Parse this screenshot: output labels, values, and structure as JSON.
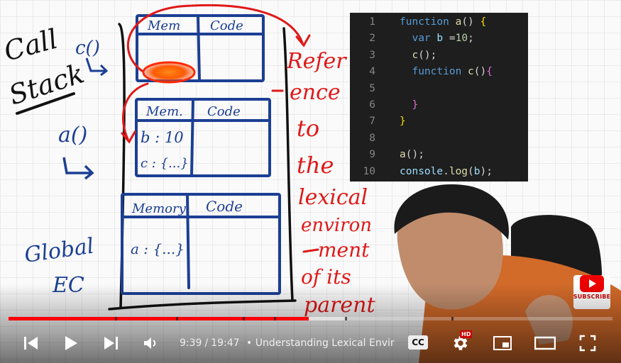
{
  "video": {
    "board": {
      "call_stack_label": [
        "Call",
        "Stack"
      ],
      "stack_entry_label": "c()",
      "a_call_label": "a()",
      "global_label": [
        "Global",
        "EC"
      ],
      "frames": [
        {
          "memory_header": "Mem",
          "code_header": "Code",
          "memory_items": []
        },
        {
          "memory_header": "Mem.",
          "code_header": "Code",
          "memory_items": [
            "b : 10",
            "c : {...}"
          ]
        },
        {
          "memory_header": "Memory",
          "code_header": "Code",
          "memory_items": [
            "a : {...}"
          ]
        }
      ],
      "annotation_words": [
        "Refer",
        "ence",
        "to",
        "the",
        "lexical",
        "environ",
        "ment",
        "of its",
        "parent"
      ]
    },
    "code": {
      "lines": [
        {
          "number": "1",
          "tokens": [
            {
              "t": "function ",
              "c": "kw"
            },
            {
              "t": "a",
              "c": "fn"
            },
            {
              "t": "() ",
              "c": "pl"
            },
            {
              "t": "{",
              "c": "br"
            }
          ]
        },
        {
          "number": "2",
          "tokens": [
            {
              "t": "  var ",
              "c": "kw"
            },
            {
              "t": "b ",
              "c": "id"
            },
            {
              "t": "=",
              "c": "pl"
            },
            {
              "t": "10",
              "c": "num"
            },
            {
              "t": ";",
              "c": "pl"
            }
          ]
        },
        {
          "number": "3",
          "tokens": [
            {
              "t": "  c",
              "c": "fn"
            },
            {
              "t": "();",
              "c": "pl"
            }
          ]
        },
        {
          "number": "4",
          "tokens": [
            {
              "t": "  function ",
              "c": "kw"
            },
            {
              "t": "c",
              "c": "fn"
            },
            {
              "t": "()",
              "c": "pl"
            },
            {
              "t": "{",
              "c": "br2"
            }
          ]
        },
        {
          "number": "5",
          "tokens": []
        },
        {
          "number": "6",
          "tokens": [
            {
              "t": "  }",
              "c": "br2"
            }
          ]
        },
        {
          "number": "7",
          "tokens": [
            {
              "t": "}",
              "c": "br"
            }
          ]
        },
        {
          "number": "8",
          "tokens": []
        },
        {
          "number": "9",
          "tokens": [
            {
              "t": "a",
              "c": "fn"
            },
            {
              "t": "();",
              "c": "pl"
            }
          ]
        },
        {
          "number": "10",
          "tokens": [
            {
              "t": "console",
              "c": "id"
            },
            {
              "t": ".",
              "c": "pl"
            },
            {
              "t": "log",
              "c": "fn"
            },
            {
              "t": "(",
              "c": "pl"
            },
            {
              "t": "b",
              "c": "id"
            },
            {
              "t": ");",
              "c": "pl"
            }
          ]
        }
      ]
    },
    "watermark": {
      "label": "SUBSCRIBE"
    }
  },
  "player": {
    "progress": {
      "played_fraction": 0.497,
      "buffered_fraction": 0.06
    },
    "time": {
      "current": "9:39",
      "separator": "/",
      "duration": "19:47"
    },
    "chapter_title": "• Understanding Lexical Envir",
    "cc_label": "CC",
    "hd_badge": "HD",
    "buttons": {
      "prev": "skip-previous-icon",
      "play": "play-icon",
      "next": "skip-next-icon",
      "volume": "volume-icon",
      "cc": "closed-captions-icon",
      "settings": "gear-icon",
      "miniplayer": "miniplayer-icon",
      "theater": "theater-mode-icon",
      "fullscreen": "fullscreen-icon"
    }
  },
  "colors": {
    "ink_blue": "#1c3f94",
    "ink_red": "#e01818",
    "ink_black": "#111111",
    "progress": "#ff0000",
    "highlight": "#ff6a00"
  }
}
